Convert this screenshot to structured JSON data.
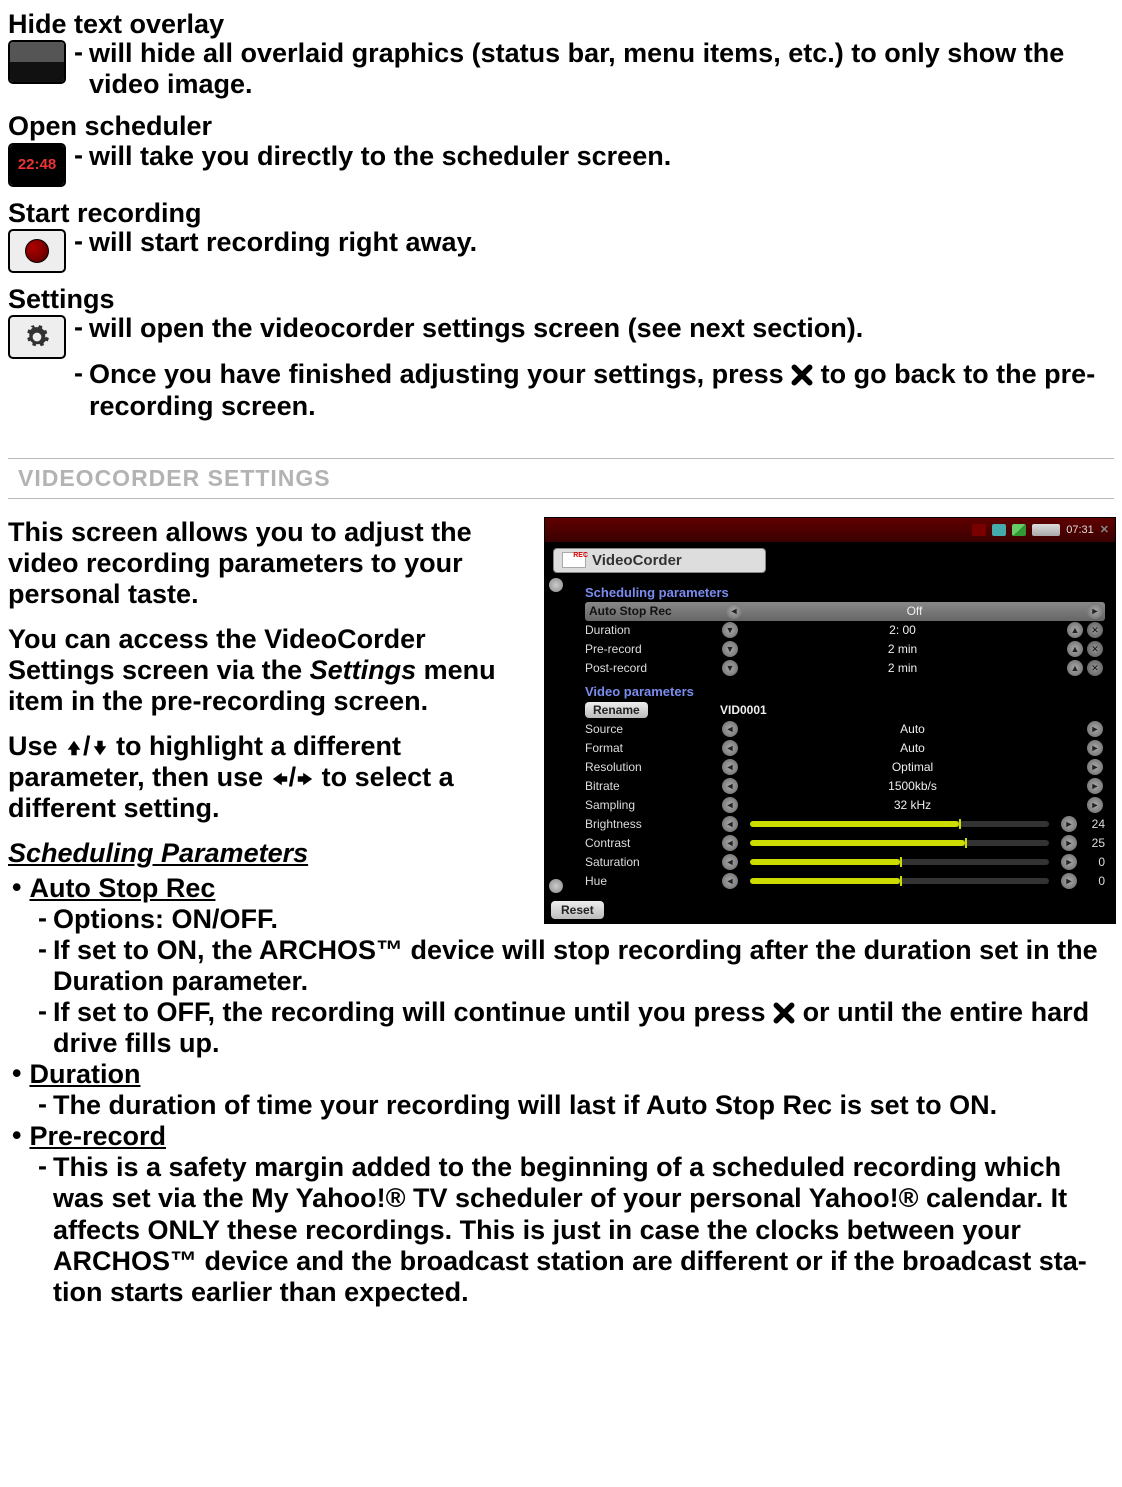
{
  "menus": {
    "hide": {
      "title": "Hide text overlay",
      "desc": "will hide all overlaid graphics (status bar, menu items, etc.) to only show the video image."
    },
    "scheduler": {
      "title": "Open scheduler",
      "desc": "will take you directly to the scheduler screen.",
      "iconText": "22:48"
    },
    "record": {
      "title": "Start recording",
      "desc": "will start recording right away."
    },
    "settings": {
      "title": "Settings",
      "desc1": "will open the videocorder settings screen (see next section).",
      "desc2a": "Once you have finished adjusting your settings, press ",
      "desc2b": " to go back to the pre-recording screen."
    }
  },
  "sectionHeading": "VIDEOCORDER SETTINGS",
  "intro": {
    "p1": "This screen allows you to adjust the video recording parameters to your personal taste.",
    "p2a": "You can access the VideoCorder Settings screen via the ",
    "p2b": "Settings",
    "p2c": " menu item in the pre-recording screen.",
    "p3a": "Use ",
    "p3b": " to highlight a different parameter, then use ",
    "p3c": " to select a different setting."
  },
  "scheduling": {
    "heading": "Scheduling Parameters",
    "autoStop": {
      "title": "Auto Stop Rec",
      "opt": "Options: ON/OFF.",
      "on": "If set to ON, the ARCHOS™ device will stop recording after the duration set in the Duration parameter.",
      "offA": "If set to OFF, the recording will continue until you press ",
      "offB": " or until the entire hard drive fills up."
    },
    "duration": {
      "title": "Duration",
      "desc": "The duration of time your recording will last if Auto Stop Rec is set to ON."
    },
    "prerecord": {
      "title": "Pre-record",
      "desc": "This is a safety margin added to the beginning of a scheduled recording which was set via the My Yahoo!® TV scheduler of your personal Yahoo!® calendar. It affects ONLY these recordings. This is just in case the clocks between your ARCHOS™ device and the broadcast station are different or if the broadcast sta­tion starts earlier than expected."
    }
  },
  "screenshot": {
    "statusTime": "07:31",
    "tab": "VideoCorder",
    "schedHeading": "Scheduling parameters",
    "videoHeading": "Video parameters",
    "rows": {
      "autoStop": {
        "label": "Auto Stop Rec",
        "value": "Off"
      },
      "duration": {
        "label": "Duration",
        "value": "2: 00"
      },
      "prerecord": {
        "label": "Pre-record",
        "value": "2 min"
      },
      "postrecord": {
        "label": "Post-record",
        "value": "2 min"
      },
      "rename": {
        "label": "Rename",
        "value": "VID0001"
      },
      "source": {
        "label": "Source",
        "value": "Auto"
      },
      "format": {
        "label": "Format",
        "value": "Auto"
      },
      "resolution": {
        "label": "Resolution",
        "value": "Optimal"
      },
      "bitrate": {
        "label": "Bitrate",
        "value": "1500kb/s"
      },
      "sampling": {
        "label": "Sampling",
        "value": "32 kHz"
      },
      "brightness": {
        "label": "Brightness",
        "value": "24",
        "fill": 70
      },
      "contrast": {
        "label": "Contrast",
        "value": "25",
        "fill": 72
      },
      "saturation": {
        "label": "Saturation",
        "value": "0",
        "fill": 50
      },
      "hue": {
        "label": "Hue",
        "value": "0",
        "fill": 50
      }
    },
    "reset": "Reset"
  }
}
